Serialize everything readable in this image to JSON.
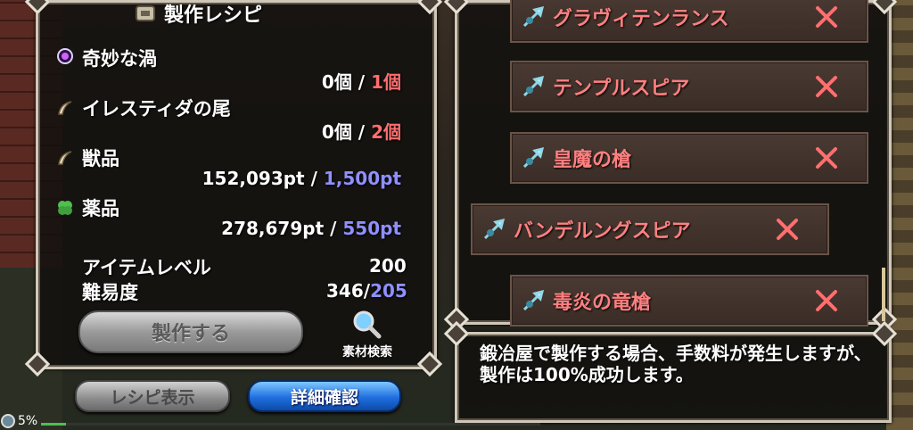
{
  "header": {
    "title": "製作レシピ"
  },
  "materials": [
    {
      "name": "奇妙な渦",
      "icon": "purple-orb-icon",
      "have": "0個",
      "sep": "/",
      "need": "1個",
      "need_color": "#ff6f6f"
    },
    {
      "name": "イレスティダの尾",
      "icon": "claw-icon",
      "have": "0個",
      "sep": "/",
      "need": "2個",
      "need_color": "#ff6f6f"
    },
    {
      "name": "獣品",
      "icon": "claw-icon",
      "have": "152,093pt",
      "sep": "/",
      "need": "1,500pt",
      "need_color": "#8f8fff"
    },
    {
      "name": "薬品",
      "icon": "clover-icon",
      "have": "278,679pt",
      "sep": "/",
      "need": "550pt",
      "need_color": "#8f8fff"
    }
  ],
  "stats": {
    "item_level_label": "アイテムレベル",
    "item_level_value": "200",
    "difficulty_label": "難易度",
    "difficulty_value": "346/",
    "difficulty_max": "205"
  },
  "buttons": {
    "craft": "製作する",
    "material_search": "素材検索",
    "show_recipe": "レシピ表示",
    "detail_confirm": "詳細確認"
  },
  "recipes": [
    {
      "name": "グラヴィテンランス",
      "icon": "spear-icon",
      "selected": false
    },
    {
      "name": "テンプルスピア",
      "icon": "spear-icon",
      "selected": false
    },
    {
      "name": "皇魔の槍",
      "icon": "spear-icon",
      "selected": false
    },
    {
      "name": "バンデルングスピア",
      "icon": "spear-icon",
      "selected": true
    },
    {
      "name": "毒炎の竜槍",
      "icon": "spear-icon",
      "selected": false
    }
  ],
  "description": "鍛冶屋で製作する場合、手数料が発生しますが、製作は100%成功します。",
  "status": {
    "hp_percent_label": "5%",
    "hp_fraction": 0.05
  },
  "colors": {
    "accent_red": "#ff6f6f",
    "accent_blue": "#8f8fff",
    "detail_button": "#1f6fe0"
  }
}
